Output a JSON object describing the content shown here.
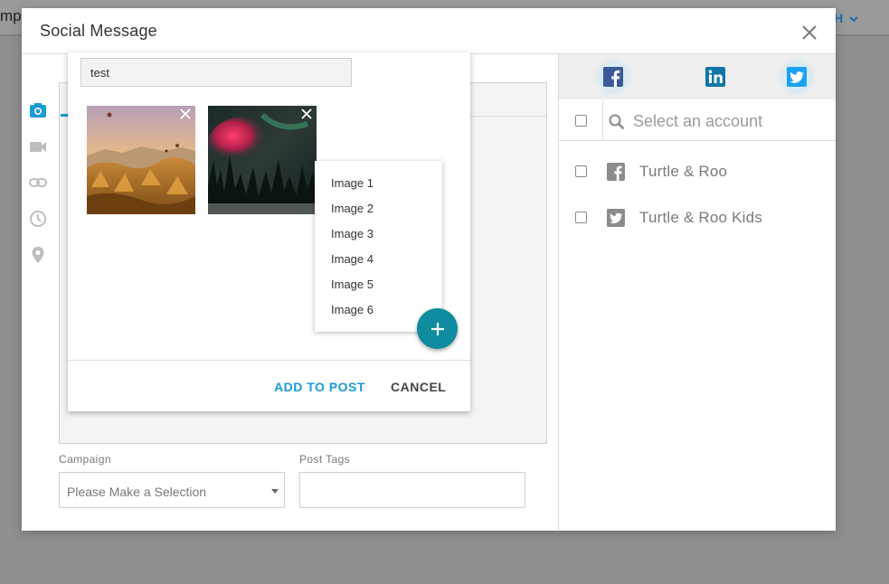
{
  "background": {
    "left_text": "mp",
    "right_text": "H"
  },
  "dialog": {
    "title": "Social Message"
  },
  "picker": {
    "input_value": "test",
    "add_label": "ADD TO POST",
    "cancel_label": "CANCEL",
    "menu_items": [
      "Image 1",
      "Image 2",
      "Image 3",
      "Image 4",
      "Image 5",
      "Image 6"
    ]
  },
  "form": {
    "campaign_label": "Campaign",
    "campaign_value": "Please Make a Selection",
    "tags_label": "Post Tags",
    "tags_value": ""
  },
  "accounts": {
    "networks": [
      "facebook-icon",
      "linkedin-icon",
      "twitter-icon"
    ],
    "search_placeholder": "Select an account",
    "items": [
      {
        "name": "Turtle & Roo",
        "network": "facebook-icon"
      },
      {
        "name": "Turtle & Roo Kids",
        "network": "twitter-icon"
      }
    ]
  },
  "colors": {
    "accent": "#1a9ad6",
    "fab": "#0e8b9e",
    "facebook": "#3b5998",
    "linkedin": "#0e76a8",
    "twitter": "#1da1f2"
  }
}
